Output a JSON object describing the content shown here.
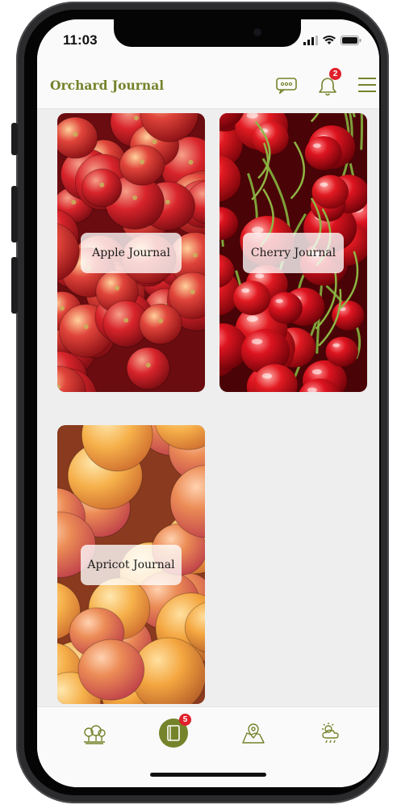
{
  "status_bar": {
    "time": "11:03"
  },
  "header": {
    "app_title": "Orchard Journal",
    "icons": [
      "chat-bubble-icon",
      "bell-icon",
      "menu-icon"
    ],
    "notification_count": "2"
  },
  "journals": [
    {
      "label": "Apple Journal",
      "image": "apples"
    },
    {
      "label": "Cherry Journal",
      "image": "cherries"
    },
    {
      "label": "Apricot Journal",
      "image": "apricots"
    }
  ],
  "tab_bar": {
    "tabs": [
      "orchard-tab",
      "journal-tab",
      "map-tab",
      "weather-tab"
    ],
    "journal_badge": "5",
    "active": "journal-tab"
  },
  "colors": {
    "accent": "#75832b",
    "badge": "#e0202a",
    "background": "#eeeeee"
  }
}
